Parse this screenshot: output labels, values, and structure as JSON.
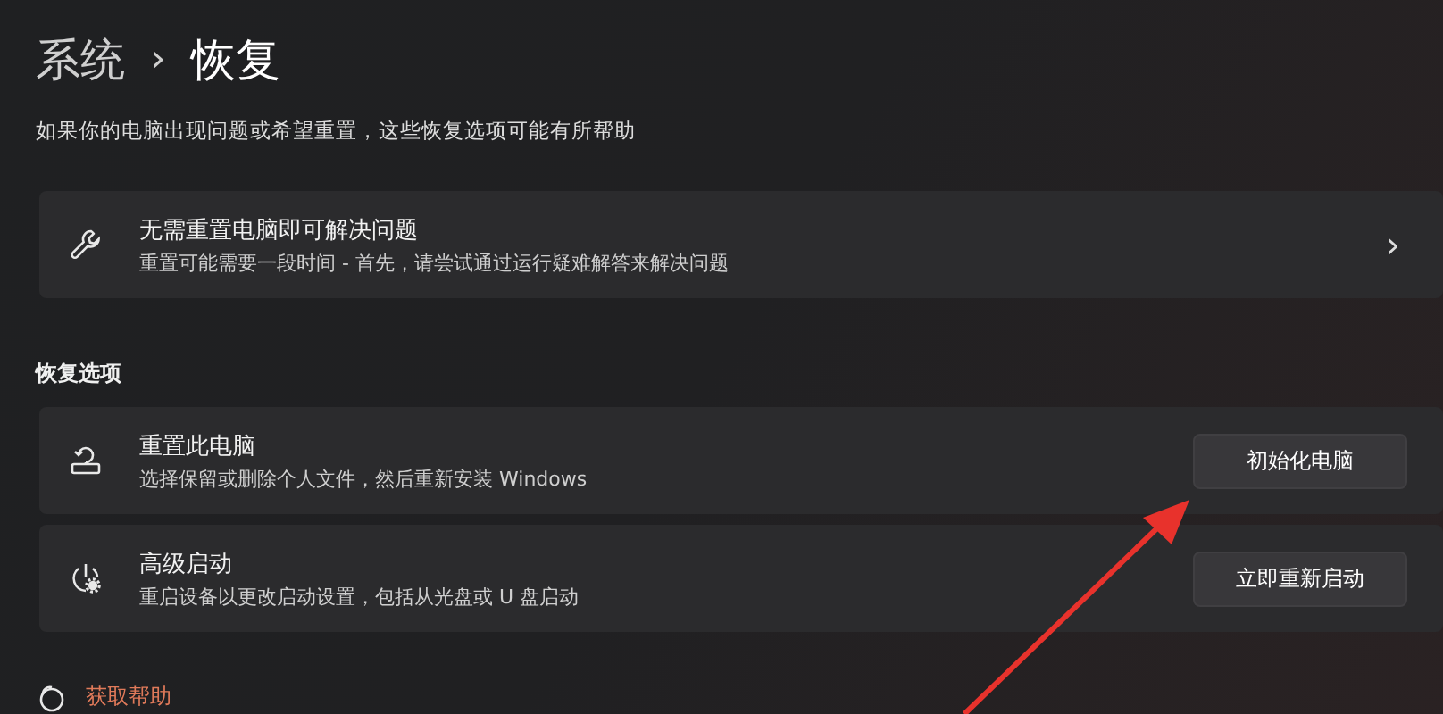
{
  "breadcrumb": {
    "parent": "系统",
    "separator": "›",
    "current": "恢复"
  },
  "description": "如果你的电脑出现问题或希望重置，这些恢复选项可能有所帮助",
  "troubleshoot_card": {
    "title": "无需重置电脑即可解决问题",
    "subtitle": "重置可能需要一段时间 - 首先，请尝试通过运行疑难解答来解决问题",
    "chevron": "›"
  },
  "section_title": "恢复选项",
  "options": [
    {
      "kind": "reset",
      "title": "重置此电脑",
      "subtitle": "选择保留或删除个人文件，然后重新安装 Windows",
      "button": "初始化电脑"
    },
    {
      "kind": "advanced",
      "title": "高级启动",
      "subtitle": "重启设备以更改启动设置，包括从光盘或 U 盘启动",
      "button": "立即重新启动"
    }
  ],
  "help_link": "获取帮助"
}
